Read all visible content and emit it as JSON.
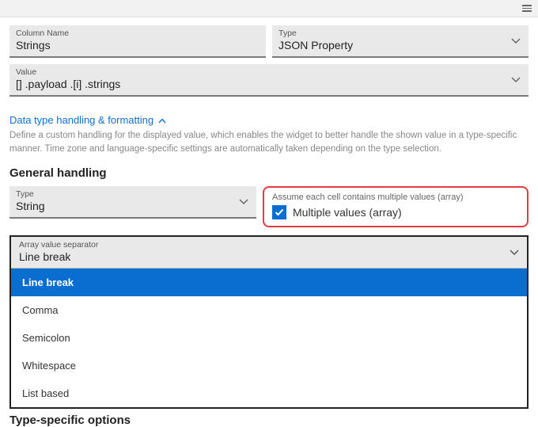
{
  "top_menu_name": "menu-icon",
  "fields": {
    "column_name": {
      "label": "Column Name",
      "value": "Strings"
    },
    "type": {
      "label": "Type",
      "value": "JSON Property"
    },
    "value": {
      "label": "Value",
      "value": "[] .payload .[i] .strings"
    }
  },
  "section": {
    "link": "Data type handling & formatting",
    "helper": "Define a custom handling for the displayed value, which enables the widget to better handle the shown value in a type-specific manner. Time zone and language-specific settings are automatically taken depending on the type selection."
  },
  "general_handling": {
    "heading": "General handling",
    "type_field": {
      "label": "Type",
      "value": "String"
    },
    "assume_label": "Assume each cell contains multiple values (array)",
    "checkbox_label": "Multiple values (array)",
    "checkbox_checked": true
  },
  "separator": {
    "label": "Array value separator",
    "value": "Line break",
    "options": [
      "Line break",
      "Comma",
      "Semicolon",
      "Whitespace",
      "List based"
    ],
    "selected_index": 0
  },
  "type_specific_heading": "Type-specific options"
}
